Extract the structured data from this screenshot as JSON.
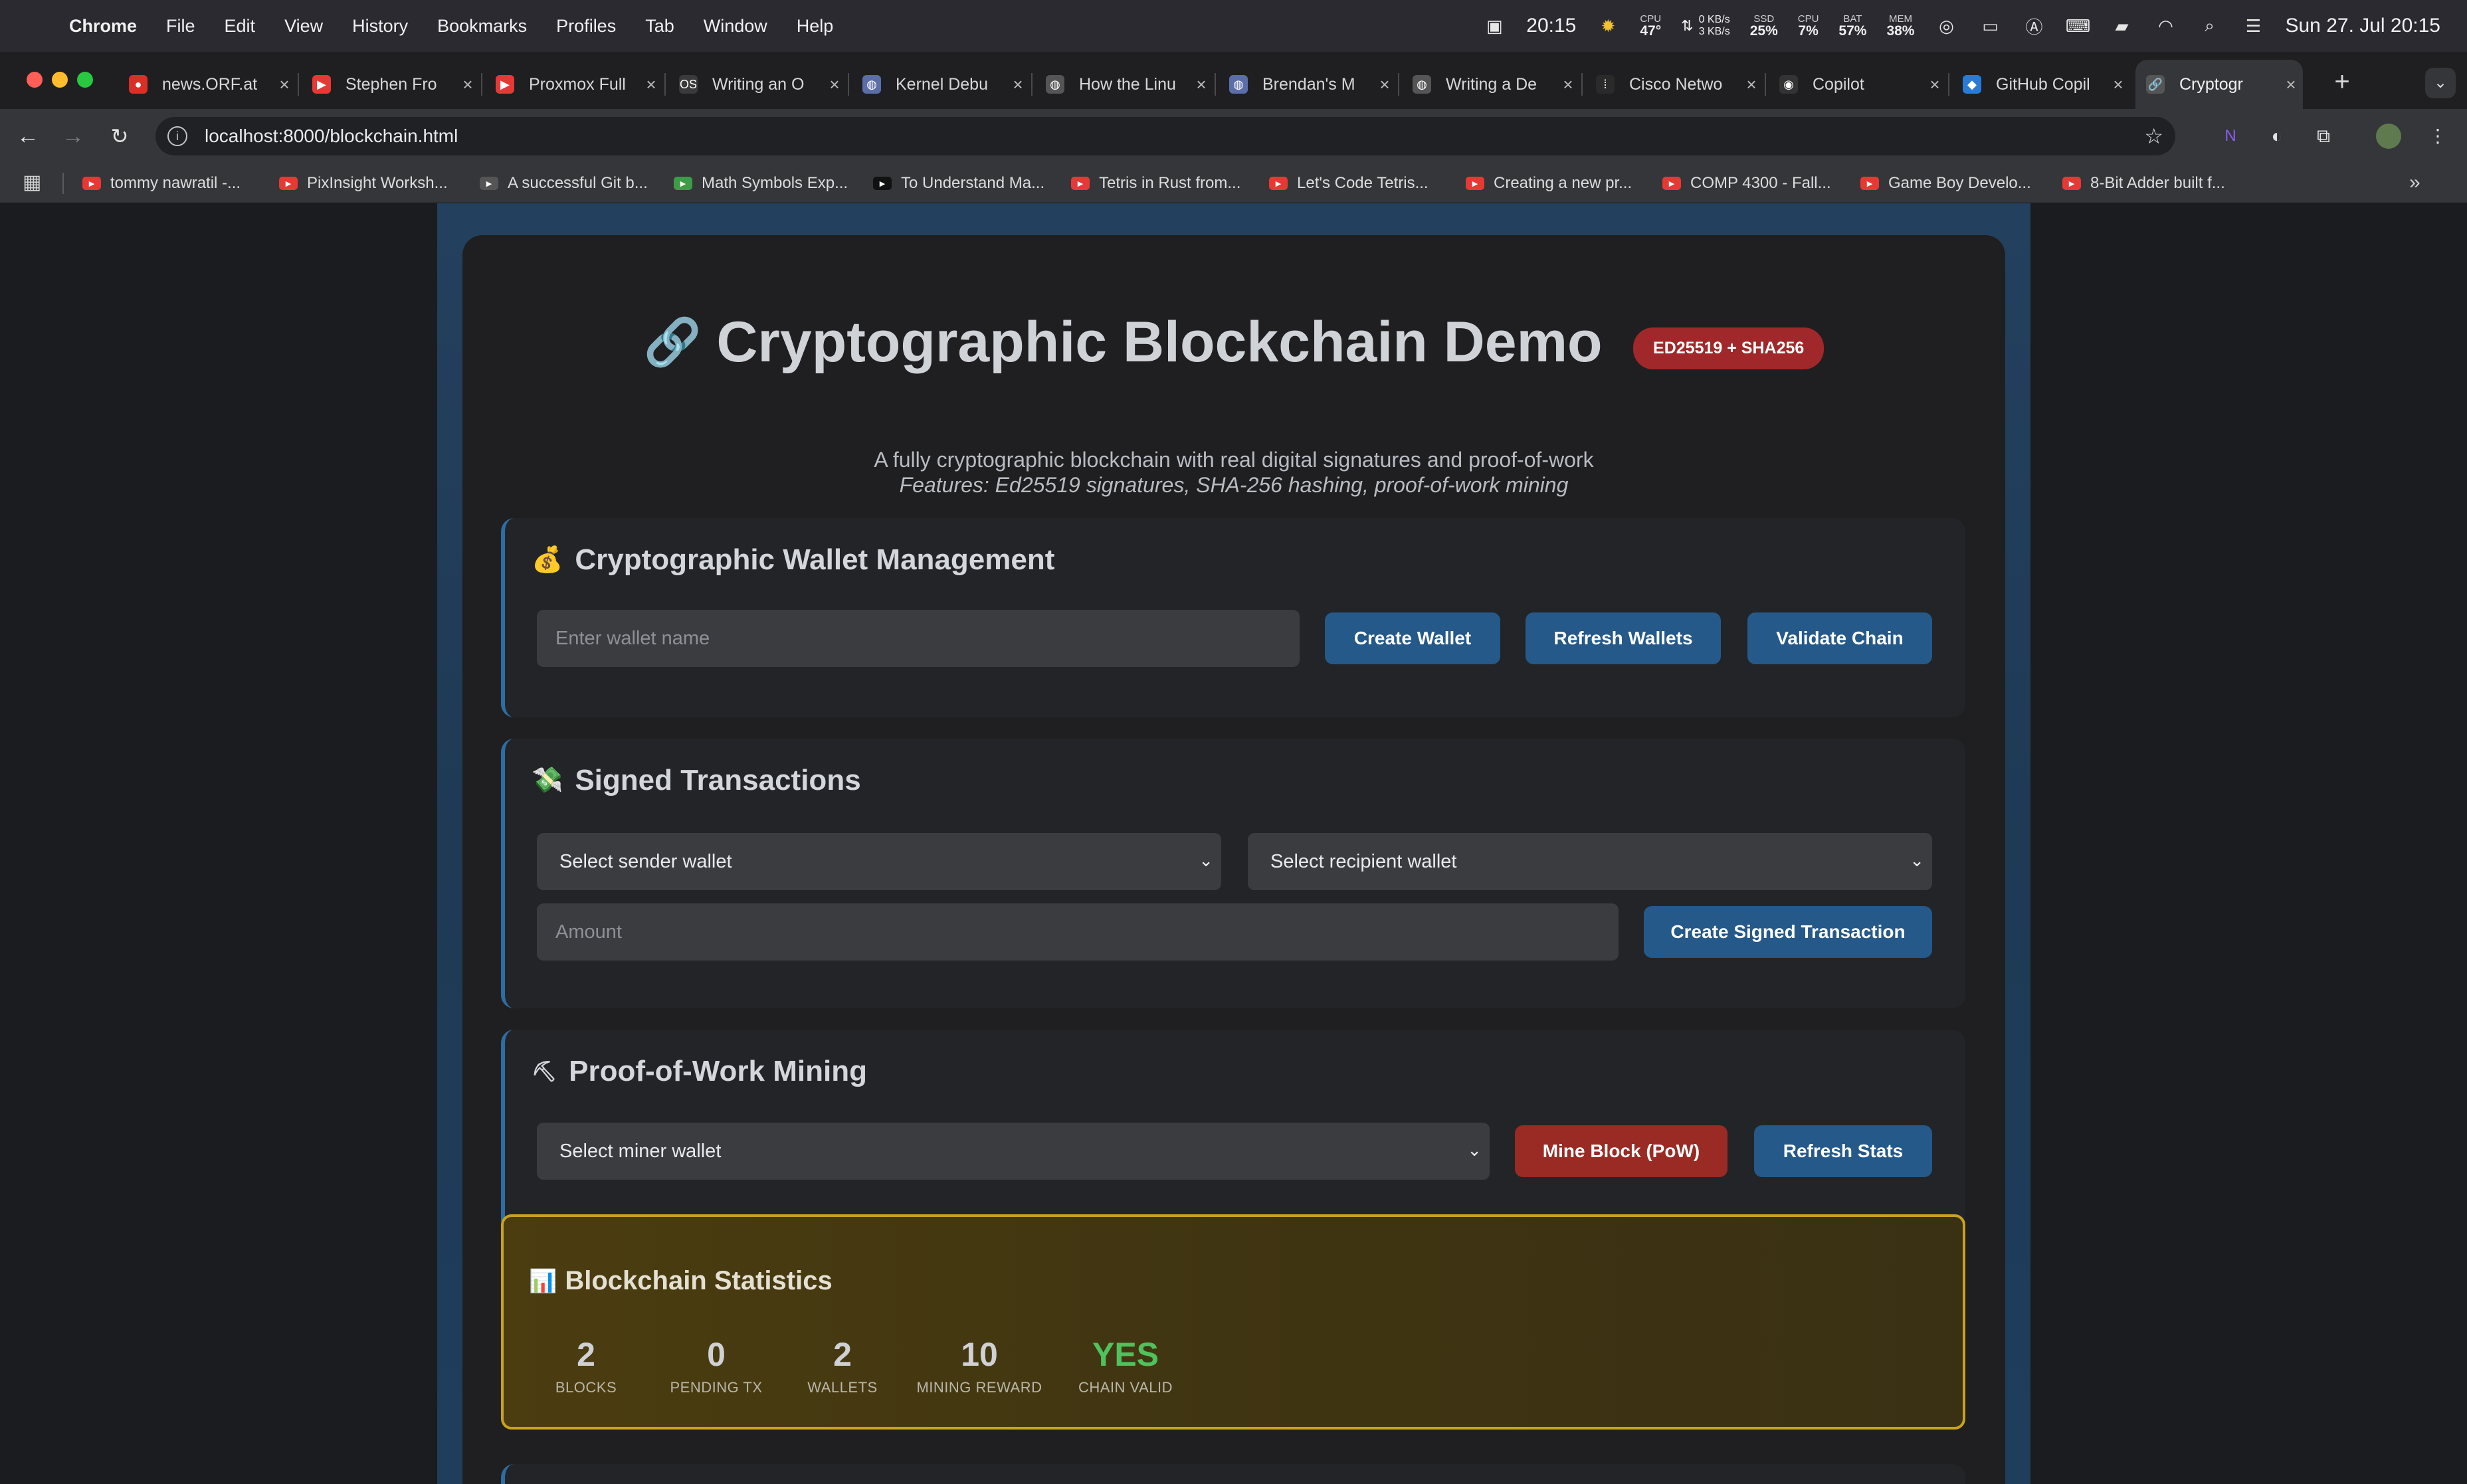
{
  "menubar": {
    "app": "Chrome",
    "items": [
      "File",
      "Edit",
      "View",
      "History",
      "Bookmarks",
      "Profiles",
      "Tab",
      "Window",
      "Help"
    ],
    "clock": "20:15",
    "cpu_temp_label": "CPU",
    "cpu_temp": "47°",
    "net_up": "0 KB/s",
    "net_down": "3 KB/s",
    "ssd_label": "SSD",
    "ssd": "25%",
    "cpu_label": "CPU",
    "cpu": "7%",
    "bat_label": "BAT",
    "bat": "57%",
    "mem_label": "MEM",
    "mem": "38%",
    "datetime": "Sun 27. Jul  20:15"
  },
  "tabs": [
    {
      "title": "news.ORF.at",
      "color": "#d93025",
      "icon": "orf-icon"
    },
    {
      "title": "Stephen Fro",
      "color": "#e53935",
      "icon": "youtube-icon"
    },
    {
      "title": "Proxmox Full",
      "color": "#e53935",
      "icon": "youtube-icon"
    },
    {
      "title": "Writing an O",
      "color": "#3a3a3a",
      "icon": "os-icon"
    },
    {
      "title": "Kernel Debu",
      "color": "#5b6ea8",
      "icon": "globe-icon"
    },
    {
      "title": "How the Linu",
      "color": "#555",
      "icon": "globe-icon"
    },
    {
      "title": "Brendan's M",
      "color": "#5b6ea8",
      "icon": "globe-icon"
    },
    {
      "title": "Writing a De",
      "color": "#555",
      "icon": "globe-icon"
    },
    {
      "title": "Cisco Netwo",
      "color": "#2a2a2a",
      "icon": "cisco-icon"
    },
    {
      "title": "Copilot",
      "color": "#333",
      "icon": "github-icon"
    },
    {
      "title": "GitHub Copil",
      "color": "#2a7bd6",
      "icon": "vscode-icon"
    },
    {
      "title": "Cryptogr",
      "color": "#555",
      "icon": "link-icon"
    }
  ],
  "toolbar": {
    "url": "localhost:8000/blockchain.html"
  },
  "bookmarks": [
    {
      "label": "tommy nawratil -...",
      "color": "#e53935"
    },
    {
      "label": "PixInsight Worksh...",
      "color": "#e53935"
    },
    {
      "label": "A successful Git b...",
      "color": "#555"
    },
    {
      "label": "Math Symbols Exp...",
      "color": "#3d9b4a"
    },
    {
      "label": "To Understand Ma...",
      "color": "#111"
    },
    {
      "label": "Tetris in Rust from...",
      "color": "#e53935"
    },
    {
      "label": "Let's Code Tetris...",
      "color": "#e53935"
    },
    {
      "label": "Creating a new pr...",
      "color": "#e53935"
    },
    {
      "label": "COMP 4300 - Fall...",
      "color": "#e53935"
    },
    {
      "label": "Game Boy Develo...",
      "color": "#e53935"
    },
    {
      "label": "8-Bit Adder built f...",
      "color": "#e53935"
    }
  ],
  "page": {
    "title": "Cryptographic Blockchain Demo",
    "badge": "ED25519 + SHA256",
    "subtitle": "A fully cryptographic blockchain with real digital signatures and proof-of-work",
    "features": "Features: Ed25519 signatures, SHA-256 hashing, proof-of-work mining",
    "wallet": {
      "heading": "Cryptographic Wallet Management",
      "placeholder": "Enter wallet name",
      "create": "Create Wallet",
      "refresh": "Refresh Wallets",
      "validate": "Validate Chain"
    },
    "transactions": {
      "heading": "Signed Transactions",
      "sender": "Select sender wallet",
      "recipient": "Select recipient wallet",
      "amount_placeholder": "Amount",
      "create": "Create Signed Transaction"
    },
    "mining": {
      "heading": "Proof-of-Work Mining",
      "miner": "Select miner wallet",
      "mine": "Mine Block (PoW)",
      "refresh": "Refresh Stats"
    },
    "stats": {
      "heading": "Blockchain Statistics",
      "items": [
        {
          "value": "2",
          "label": "BLOCKS"
        },
        {
          "value": "0",
          "label": "PENDING TX"
        },
        {
          "value": "2",
          "label": "WALLETS"
        },
        {
          "value": "10",
          "label": "MINING REWARD"
        },
        {
          "value": "YES",
          "label": "CHAIN VALID"
        }
      ]
    }
  }
}
